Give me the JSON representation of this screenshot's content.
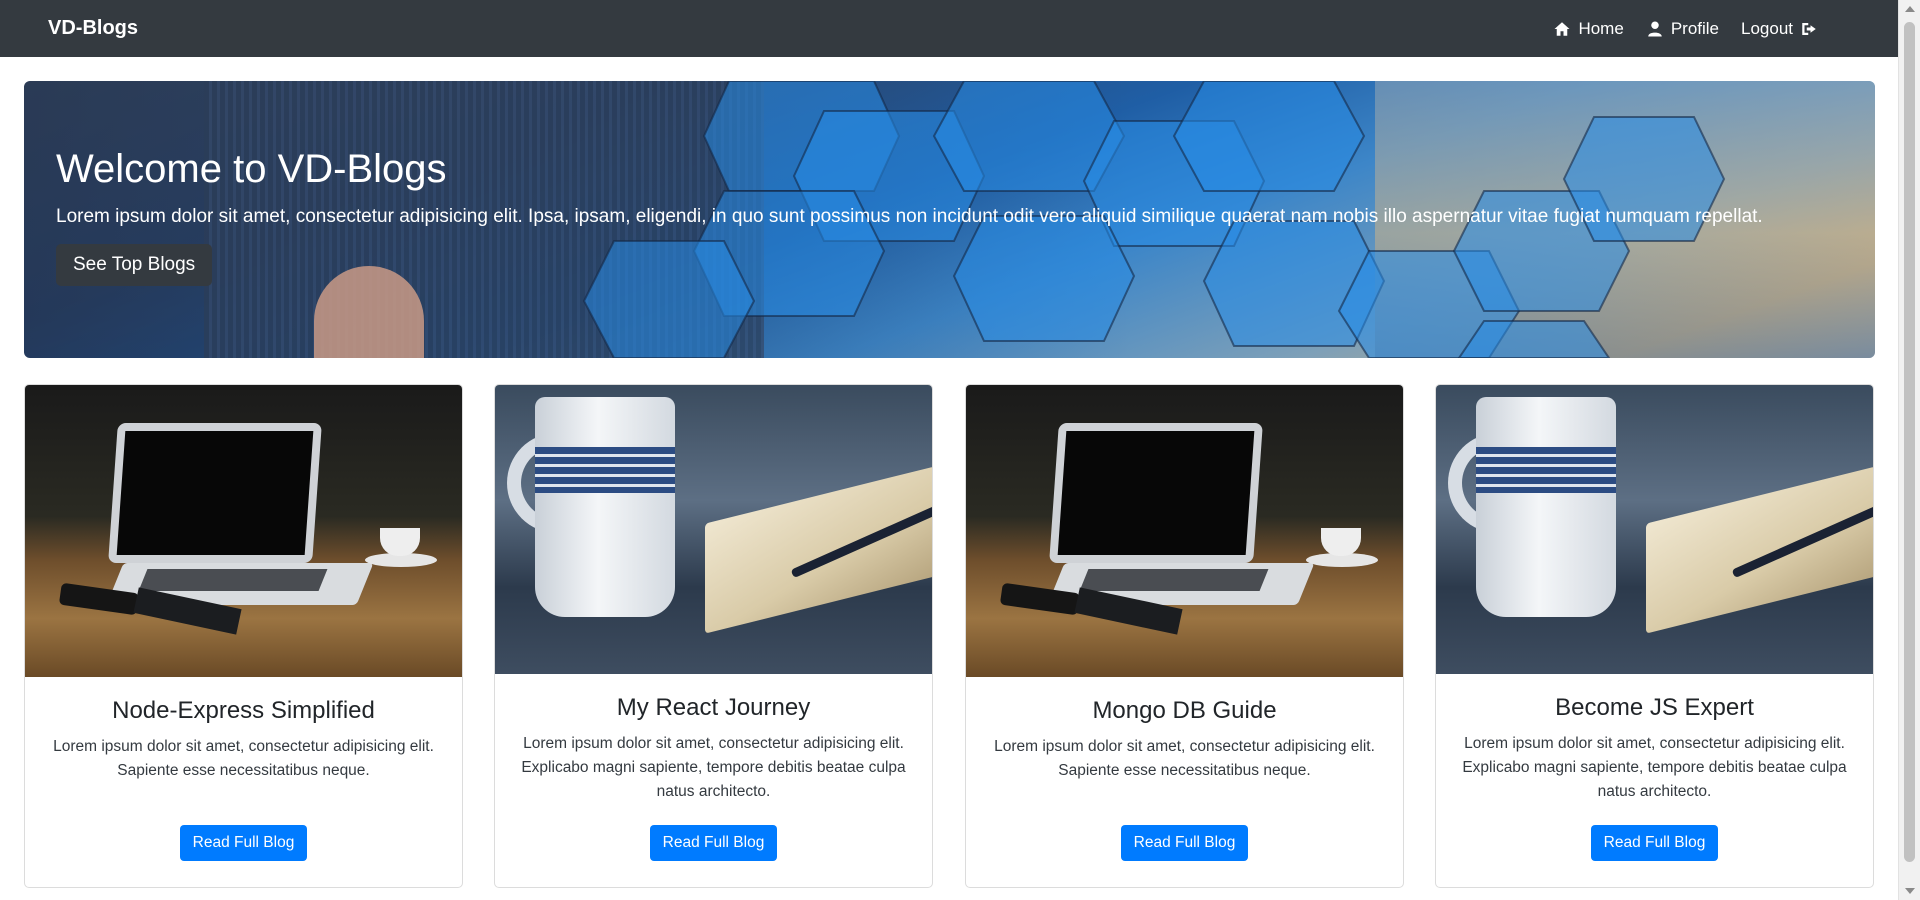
{
  "nav": {
    "brand": "VD-Blogs",
    "links": [
      {
        "label": "Home",
        "icon": "home-icon"
      },
      {
        "label": "Profile",
        "icon": "user-icon"
      },
      {
        "label": "Logout",
        "icon": "sign-out-icon"
      }
    ]
  },
  "hero": {
    "title": "Welcome to VD-Blogs",
    "text": "Lorem ipsum dolor sit amet, consectetur adipisicing elit. Ipsa, ipsam, eligendi, in quo sunt possimus non incidunt odit vero aliquid similique quaerat nam nobis illo aspernatur vitae fugiat numquam repellat.",
    "button": "See Top Blogs"
  },
  "cards": [
    {
      "image": "laptop-on-table",
      "title": "Node-Express Simplified",
      "text": "Lorem ipsum dolor sit amet, consectetur adipisicing elit. Sapiente esse necessitatibus neque.",
      "button": "Read Full Blog"
    },
    {
      "image": "mug-and-book",
      "title": "My React Journey",
      "text": "Lorem ipsum dolor sit amet, consectetur adipisicing elit. Explicabo magni sapiente, tempore debitis beatae culpa natus architecto.",
      "button": "Read Full Blog"
    },
    {
      "image": "laptop-on-table",
      "title": "Mongo DB Guide",
      "text": "Lorem ipsum dolor sit amet, consectetur adipisicing elit. Sapiente esse necessitatibus neque.",
      "button": "Read Full Blog"
    },
    {
      "image": "mug-and-book",
      "title": "Become JS Expert",
      "text": "Lorem ipsum dolor sit amet, consectetur adipisicing elit. Explicabo magni sapiente, tempore debitis beatae culpa natus architecto.",
      "button": "Read Full Blog"
    }
  ],
  "colors": {
    "navbar": "#343a40",
    "primary": "#007bff",
    "hero_button": "#343a40"
  }
}
